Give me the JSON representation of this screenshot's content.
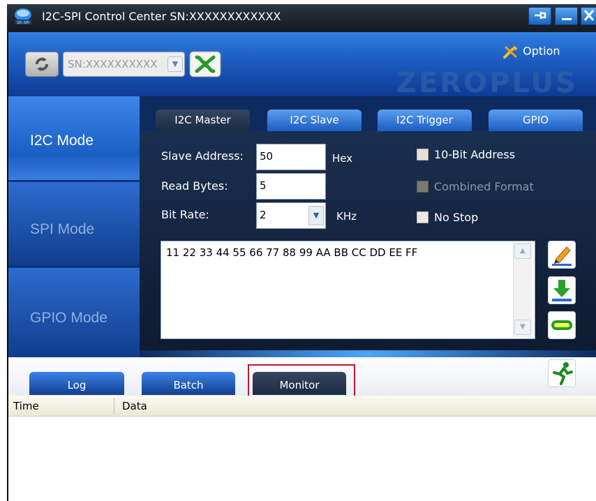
{
  "window": {
    "title": "I2C-SPI Control Center SN:XXXXXXXXXXXX",
    "app_icon_label": "I2C-SPI"
  },
  "header": {
    "sn_select_value": "SN:XXXXXXXXXX",
    "option_label": "Option",
    "brand_logo": "ZEROPLUS"
  },
  "modes": [
    {
      "label": "I2C Mode",
      "selected": true
    },
    {
      "label": "SPI Mode",
      "selected": false
    },
    {
      "label": "GPIO Mode",
      "selected": false
    }
  ],
  "subtabs": [
    {
      "label": "I2C Master",
      "selected": true
    },
    {
      "label": "I2C Slave",
      "selected": false
    },
    {
      "label": "I2C Trigger",
      "selected": false
    },
    {
      "label": "GPIO",
      "selected": false
    }
  ],
  "form": {
    "slave_address_label": "Slave Address:",
    "slave_address_value": "50",
    "hex_label": "Hex",
    "read_bytes_label": "Read Bytes:",
    "read_bytes_value": "5",
    "bit_rate_label": "Bit Rate:",
    "bit_rate_value": "2",
    "khz_label": "KHz",
    "ten_bit_label": "10-Bit Address",
    "combined_label": "Combined Format",
    "no_stop_label": "No Stop",
    "data_text": "11 22 33 44 55 66 77 88 99 AA BB CC DD EE FF"
  },
  "bottom_tabs": [
    {
      "label": "Log",
      "selected": false
    },
    {
      "label": "Batch",
      "selected": false
    },
    {
      "label": "Monitor",
      "selected": true
    }
  ],
  "log_table": {
    "columns": [
      "Time",
      "Data"
    ]
  },
  "colors": {
    "highlight": "#c0182a",
    "accent": "#1d5fc4"
  }
}
